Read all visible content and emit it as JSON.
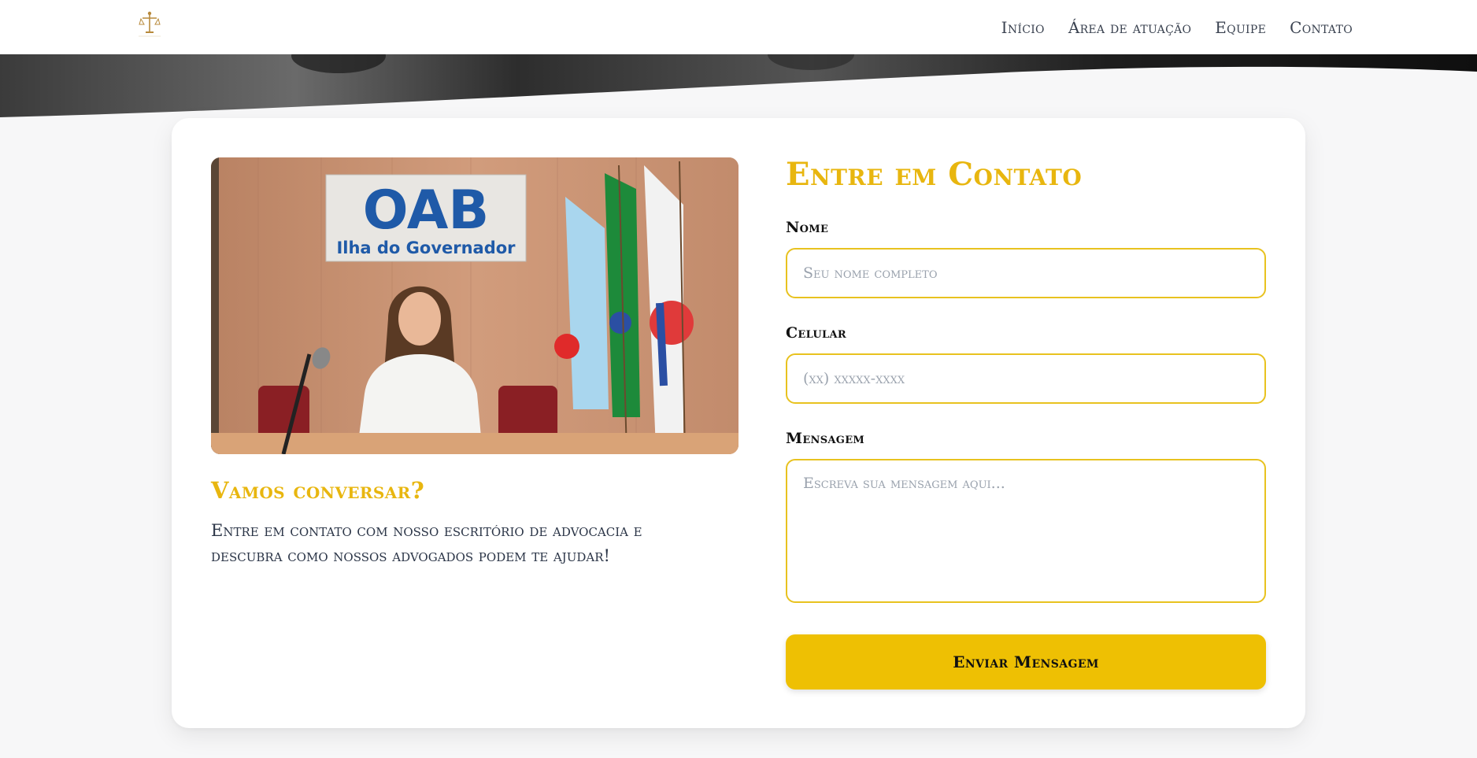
{
  "navbar": {
    "logo_icon": "scales-of-justice-logo-icon",
    "links": [
      "Início",
      "Área de atuação",
      "Equipe",
      "Contato"
    ]
  },
  "contact_intro": {
    "photo_sign_line1": "OAB",
    "photo_sign_line2": "Ilha do Governador",
    "title": "Vamos conversar?",
    "text": "Entre em contato com nosso escritório de advocacia e descubra como nossos advogados podem te ajudar!"
  },
  "form": {
    "title": "Entre em Contato",
    "name_label": "Nome",
    "name_placeholder": "Seu nome completo",
    "phone_label": "Celular",
    "phone_placeholder": "(xx) xxxxx-xxxx",
    "message_label": "Mensagem",
    "message_placeholder": "Escreva sua mensagem aqui...",
    "submit_label": "Enviar Mensagem"
  },
  "colors": {
    "accent": "#e8b60f",
    "button": "#eec003",
    "input_border": "#e8c21f"
  }
}
